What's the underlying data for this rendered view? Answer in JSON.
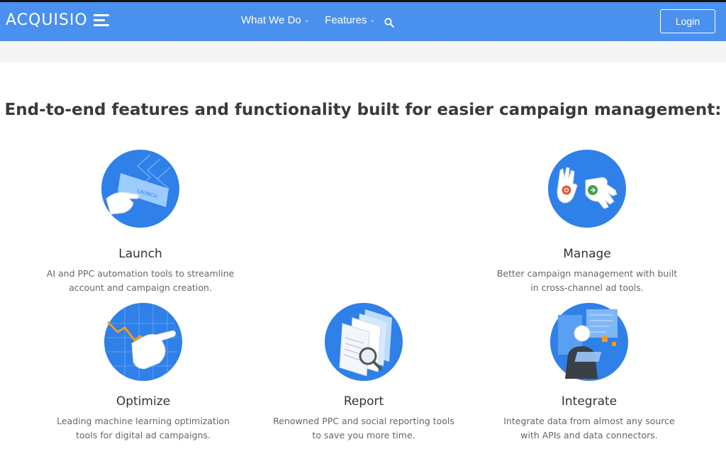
{
  "brand": {
    "name": "ACQUISIO"
  },
  "nav": {
    "items": [
      {
        "label": "What We Do"
      },
      {
        "label": "Features"
      }
    ],
    "login_label": "Login"
  },
  "main": {
    "headline": "End-to-end features and functionality built for easier campaign management:",
    "features": [
      {
        "title": "Launch",
        "desc_line1": "AI and PPC automation tools to streamline",
        "desc_line2": "account and campaign creation.",
        "sign_text": "LAUNCH"
      },
      {
        "title": "Manage",
        "desc_line1": "Better campaign management with built",
        "desc_line2": "in cross-channel ad tools."
      },
      {
        "title": "Optimize",
        "desc_line1": "Leading machine learning optimization",
        "desc_line2": "tools for digital ad campaigns."
      },
      {
        "title": "Report",
        "desc_line1": "Renowned PPC and social reporting tools",
        "desc_line2": "to save you more time."
      },
      {
        "title": "Integrate",
        "desc_line1": "Integrate data from almost any source",
        "desc_line2": "with APIs and data connectors."
      }
    ]
  },
  "colors": {
    "nav_bg": "#4a90ee",
    "circle_blue": "#2f80e8",
    "text_dark": "#333333",
    "text_muted": "#666666"
  },
  "icons": {
    "chevron": "chevron-down-icon",
    "search": "search-icon",
    "logo_mark": "logo-bars-icon"
  }
}
